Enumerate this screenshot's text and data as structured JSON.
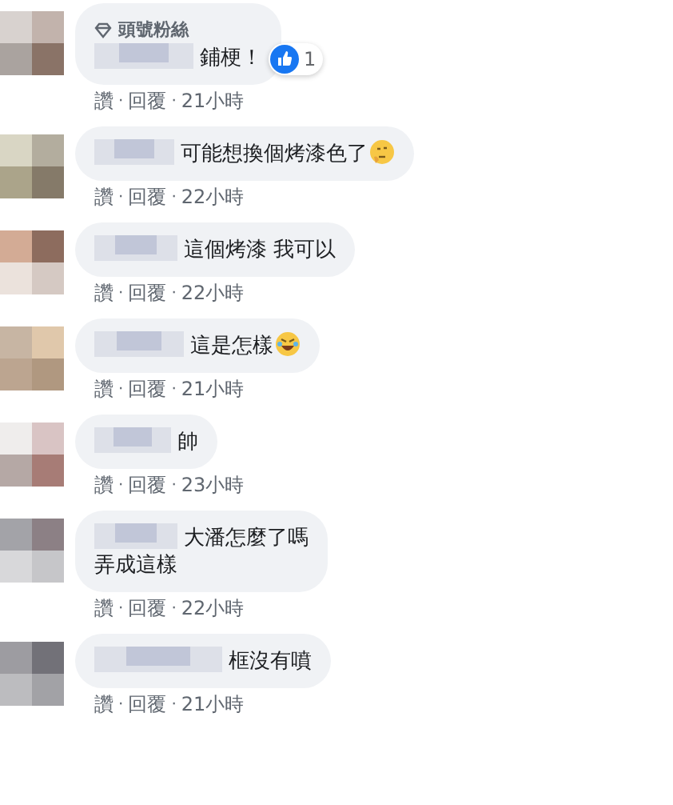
{
  "comments": [
    {
      "badge": "頭號粉絲",
      "text": "鋪梗！",
      "reaction_count": "1",
      "like": "讚",
      "reply": "回覆",
      "separators": [
        "·",
        "·"
      ],
      "time": "21小時"
    },
    {
      "text": "可能想換個烤漆色了",
      "emoji": {
        "kind": "thinking"
      },
      "like": "讚",
      "reply": "回覆",
      "separators": [
        "·",
        "·"
      ],
      "time": "22小時"
    },
    {
      "text": "這個烤漆 我可以",
      "like": "讚",
      "reply": "回覆",
      "separators": [
        "·",
        "·"
      ],
      "time": "22小時"
    },
    {
      "text": "這是怎樣",
      "emoji": {
        "kind": "laughing"
      },
      "like": "讚",
      "reply": "回覆",
      "separators": [
        "·",
        "·"
      ],
      "time": "21小時"
    },
    {
      "text": "帥",
      "like": "讚",
      "reply": "回覆",
      "separators": [
        "·",
        "·"
      ],
      "time": "23小時"
    },
    {
      "text": "大潘怎麼了嗎",
      "text_continued": "弄成這樣",
      "like": "讚",
      "reply": "回覆",
      "separators": [
        "·",
        "·"
      ],
      "time": "22小時"
    },
    {
      "text": "框沒有噴",
      "like": "讚",
      "reply": "回覆",
      "separators": [
        "·",
        "·"
      ],
      "time": "21小時"
    }
  ]
}
